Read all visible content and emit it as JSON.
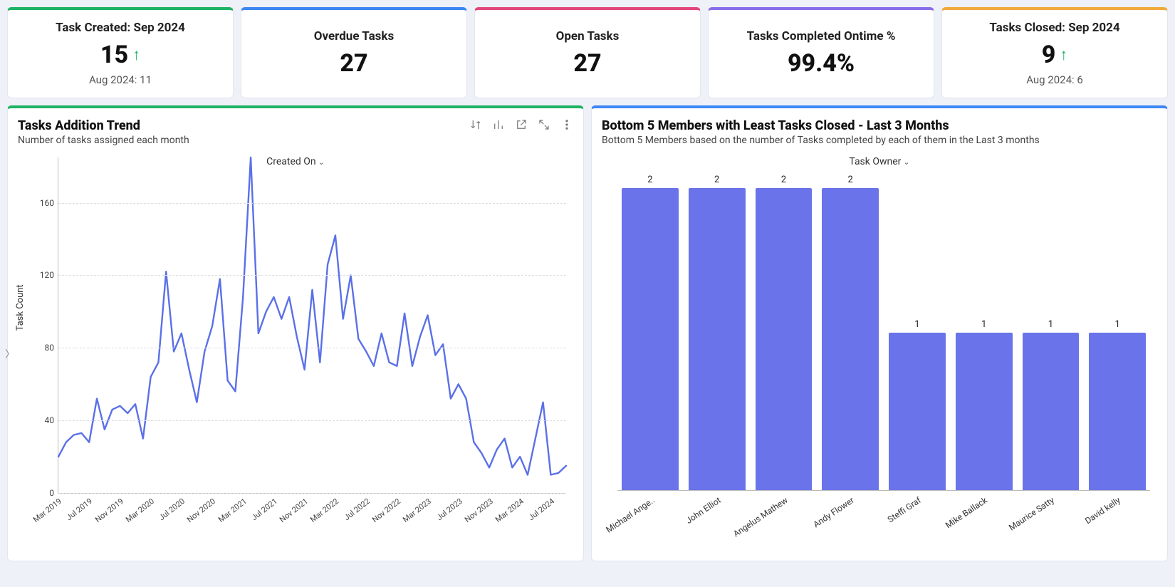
{
  "kpis": [
    {
      "title": "Task Created: Sep 2024",
      "value": "15",
      "trend_up": true,
      "sub": "Aug 2024: 11",
      "accent": "#1fb365"
    },
    {
      "title": "Overdue Tasks",
      "value": "27",
      "trend_up": false,
      "sub": "",
      "accent": "#3c86f5"
    },
    {
      "title": "Open Tasks",
      "value": "27",
      "trend_up": false,
      "sub": "",
      "accent": "#e2467c"
    },
    {
      "title": "Tasks Completed Ontime %",
      "value": "99.4%",
      "trend_up": false,
      "sub": "",
      "accent": "#8a6de8"
    },
    {
      "title": "Tasks Closed: Sep 2024",
      "value": "9",
      "trend_up": true,
      "sub": "Aug 2024: 6",
      "accent": "#f0a93b"
    }
  ],
  "trend_card": {
    "title": "Tasks Addition Trend",
    "subtitle": "Number of tasks assigned each month",
    "ylabel": "Task Count",
    "xlabel": "Created On",
    "accent": "#1fb365"
  },
  "bar_card": {
    "title": "Bottom 5 Members with Least Tasks Closed - Last 3 Months",
    "subtitle": "Bottom 5 Members based on the number of Tasks completed by each of them in the Last 3 months",
    "xlabel": "Task Owner",
    "accent": "#3c86f5"
  },
  "chart_data": [
    {
      "type": "line",
      "title": "Tasks Addition Trend",
      "subtitle": "Number of tasks assigned each month",
      "xlabel": "Created On",
      "ylabel": "Task Count",
      "ylim": [
        0,
        185
      ],
      "yticks": [
        0,
        40,
        80,
        120,
        160
      ],
      "xtick_labels": [
        "Mar 2019",
        "Jul 2019",
        "Nov 2019",
        "Mar 2020",
        "Jul 2020",
        "Nov 2020",
        "Mar 2021",
        "Jul 2021",
        "Nov 2021",
        "Mar 2022",
        "Jul 2022",
        "Nov 2022",
        "Mar 2023",
        "Jul 2023",
        "Nov 2023",
        "Mar 2024",
        "Jul 2024"
      ],
      "x": [
        "Mar 2019",
        "Apr 2019",
        "May 2019",
        "Jun 2019",
        "Jul 2019",
        "Aug 2019",
        "Sep 2019",
        "Oct 2019",
        "Nov 2019",
        "Dec 2019",
        "Jan 2020",
        "Feb 2020",
        "Mar 2020",
        "Apr 2020",
        "May 2020",
        "Jun 2020",
        "Jul 2020",
        "Aug 2020",
        "Sep 2020",
        "Oct 2020",
        "Nov 2020",
        "Dec 2020",
        "Jan 2021",
        "Feb 2021",
        "Mar 2021",
        "Apr 2021",
        "May 2021",
        "Jun 2021",
        "Jul 2021",
        "Aug 2021",
        "Sep 2021",
        "Oct 2021",
        "Nov 2021",
        "Dec 2021",
        "Jan 2022",
        "Feb 2022",
        "Mar 2022",
        "Apr 2022",
        "May 2022",
        "Jun 2022",
        "Jul 2022",
        "Aug 2022",
        "Sep 2022",
        "Oct 2022",
        "Nov 2022",
        "Dec 2022",
        "Jan 2023",
        "Feb 2023",
        "Mar 2023",
        "Apr 2023",
        "May 2023",
        "Jun 2023",
        "Jul 2023",
        "Aug 2023",
        "Sep 2023",
        "Oct 2023",
        "Nov 2023",
        "Dec 2023",
        "Jan 2024",
        "Feb 2024",
        "Mar 2024",
        "Apr 2024",
        "May 2024",
        "Jun 2024",
        "Jul 2024",
        "Aug 2024",
        "Sep 2024"
      ],
      "values": [
        20,
        28,
        32,
        33,
        28,
        52,
        35,
        46,
        48,
        44,
        49,
        30,
        64,
        72,
        122,
        78,
        88,
        68,
        50,
        78,
        92,
        118,
        62,
        56,
        108,
        185,
        88,
        100,
        108,
        96,
        108,
        86,
        68,
        112,
        72,
        126,
        142,
        96,
        120,
        85,
        78,
        70,
        88,
        72,
        70,
        99,
        70,
        86,
        98,
        76,
        82,
        52,
        60,
        52,
        28,
        22,
        14,
        24,
        30,
        14,
        20,
        10,
        30,
        50,
        10,
        11,
        15
      ]
    },
    {
      "type": "bar",
      "title": "Bottom 5 Members with Least Tasks Closed - Last 3 Months",
      "xlabel": "Task Owner",
      "ylabel": "",
      "ylim": [
        0,
        2
      ],
      "categories": [
        "Michael Ange..",
        "John Elliot",
        "Angelus Mathew",
        "Andy Flower",
        "Steffi Graf",
        "Mike Ballack",
        "Maurice Satty",
        "David kelly"
      ],
      "values": [
        2,
        2,
        2,
        2,
        1,
        1,
        1,
        1
      ]
    }
  ]
}
